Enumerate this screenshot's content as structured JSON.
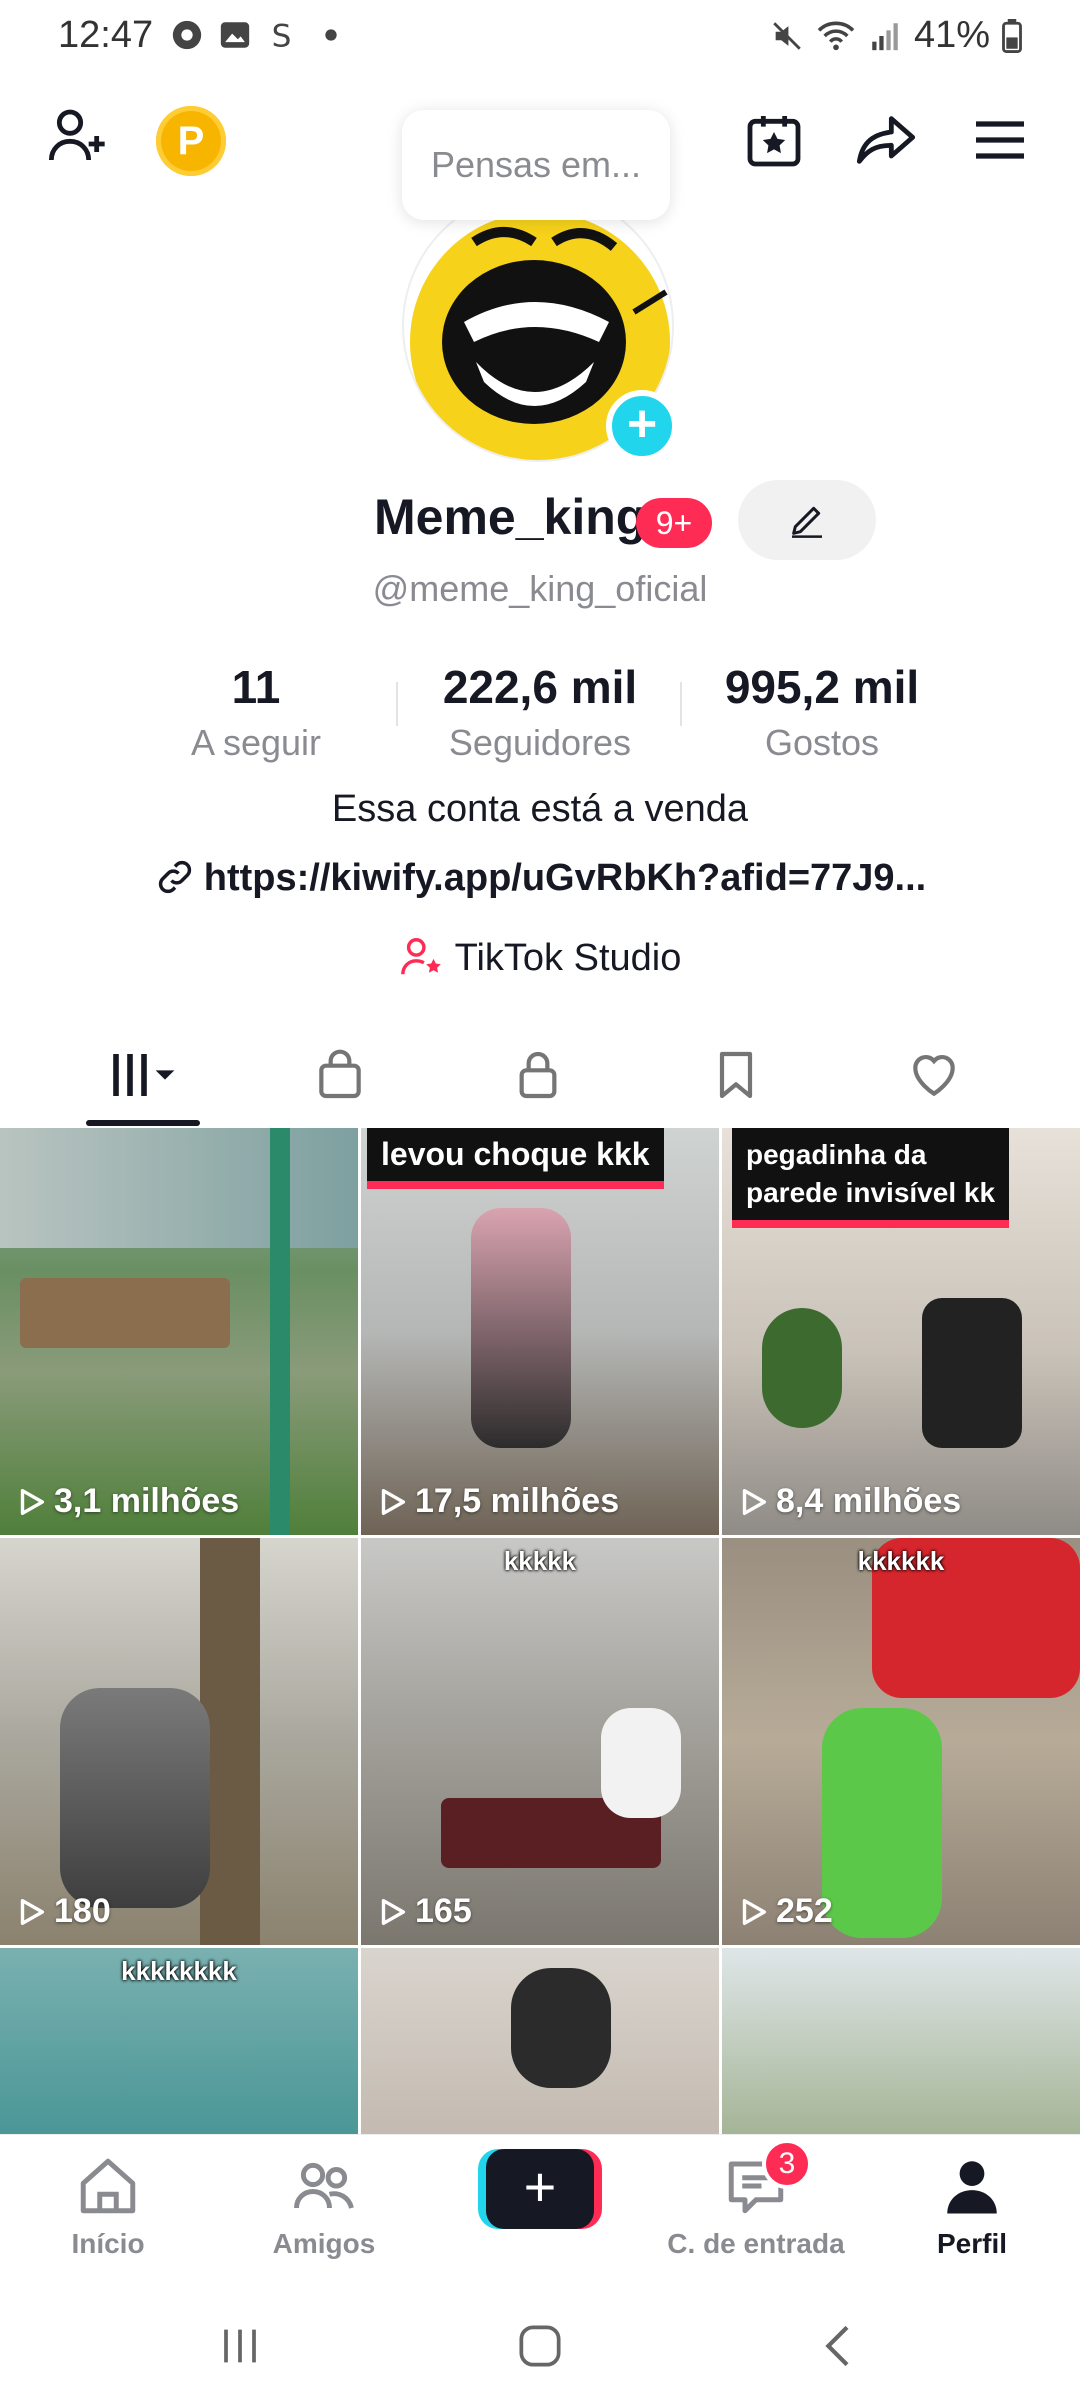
{
  "status_bar": {
    "time": "12:47",
    "battery": "41%"
  },
  "top": {
    "coin_letter": "P",
    "thought_bubble": "Pensas em..."
  },
  "profile": {
    "name": "Meme_king",
    "notification_badge": "9+",
    "handle": "@meme_king_oficial",
    "stats": [
      {
        "value": "11",
        "label": "A seguir"
      },
      {
        "value": "222,6 mil",
        "label": "Seguidores"
      },
      {
        "value": "995,2 mil",
        "label": "Gostos"
      }
    ],
    "bio": "Essa conta está a venda",
    "link": "https://kiwify.app/uGvRbKh?afid=77J9...",
    "studio": "TikTok Studio"
  },
  "videos": [
    {
      "views": "3,1 milhões",
      "caption": ""
    },
    {
      "views": "17,5 milhões",
      "caption": "levou choque kkk"
    },
    {
      "views": "8,4 milhões",
      "caption_line1": "pegadinha da",
      "caption_line2": "parede invisível kk"
    },
    {
      "views": "180",
      "caption": ""
    },
    {
      "views": "165",
      "caption": "kkkkk"
    },
    {
      "views": "252",
      "caption": "kkkkkk"
    },
    {
      "caption": "kkkkkkkk"
    }
  ],
  "bottom_nav": {
    "home": "Início",
    "friends": "Amigos",
    "inbox": "C. de entrada",
    "inbox_badge": "3",
    "profile": "Perfil"
  },
  "colors": {
    "accent_red": "#fe2c55",
    "accent_cyan": "#20d5ec",
    "coin": "#f7b500"
  }
}
